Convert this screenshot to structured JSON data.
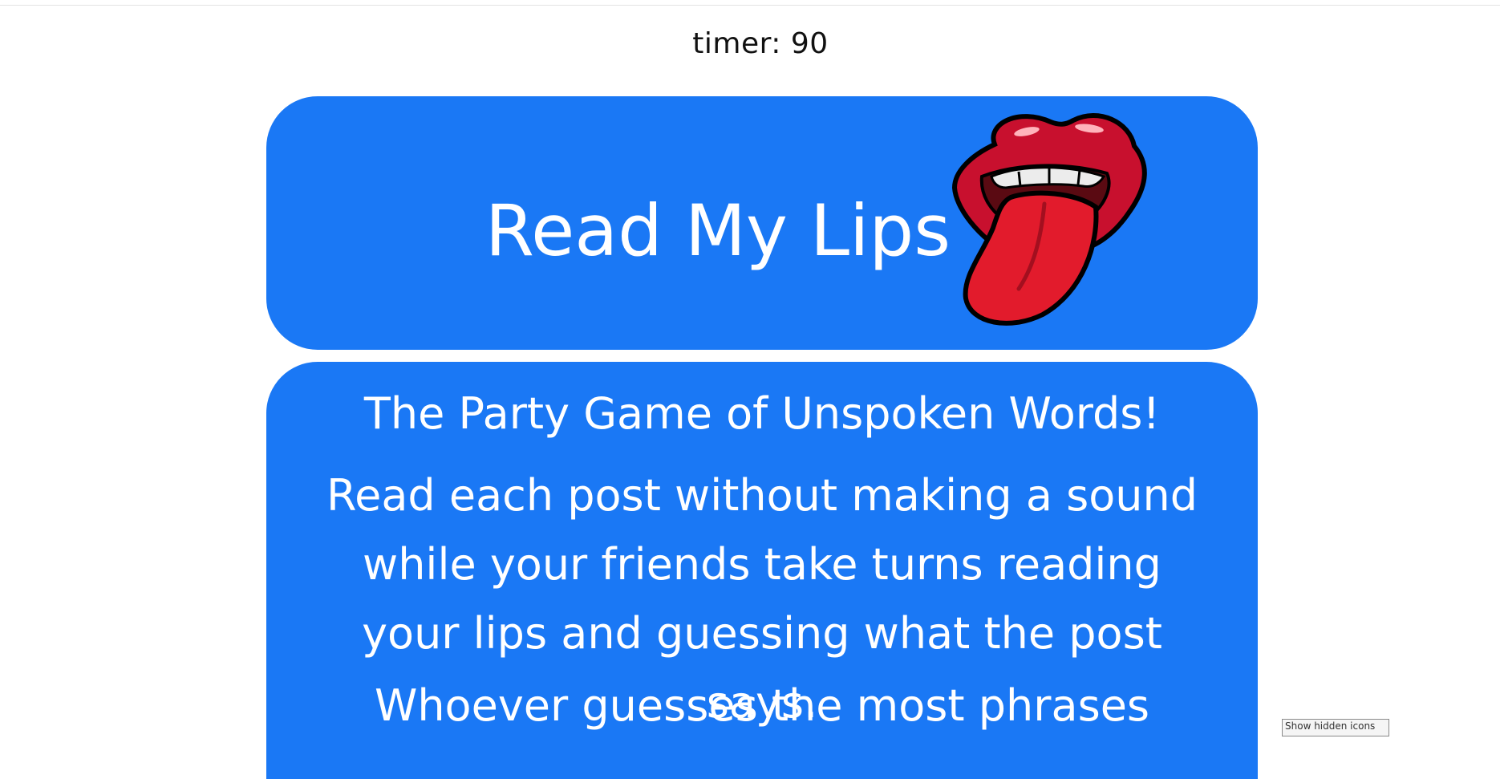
{
  "timer": {
    "text": "timer: 90"
  },
  "hero": {
    "title": "Read My Lips",
    "logo_icon": "lips-tongue-icon"
  },
  "info": {
    "subtitle": "The Party Game of Unspoken Words!",
    "description": "Read each post without making a sound while your friends take turns reading your lips and guessing what the post says.",
    "winner_line": "Whoever guesses the most phrases"
  },
  "tooltip": {
    "text": "Show hidden icons"
  },
  "colors": {
    "card_blue": "#1a78f5",
    "text_white": "#ffffff",
    "lip_red": "#c8102e",
    "tongue_red": "#e21b2c"
  }
}
